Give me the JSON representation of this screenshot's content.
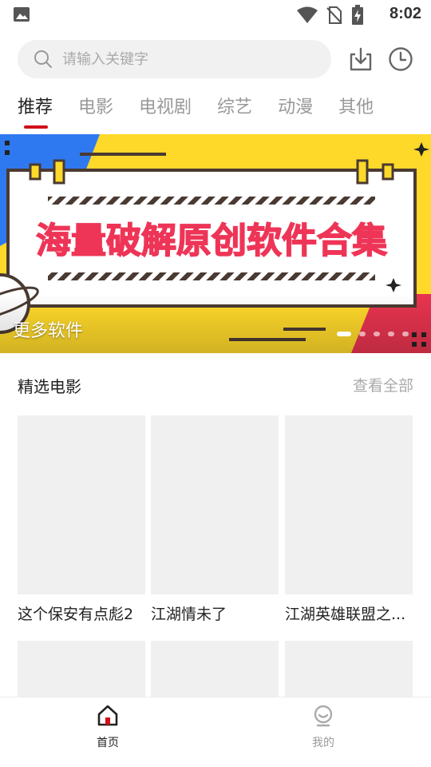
{
  "status_bar": {
    "time": "8:02",
    "icons": [
      "gallery-icon",
      "wifi-icon",
      "no-sim-icon",
      "battery-charging-icon"
    ]
  },
  "search": {
    "placeholder": "请输入关键字"
  },
  "header_actions": [
    "download-icon",
    "history-icon"
  ],
  "tabs": [
    {
      "label": "推荐",
      "active": true
    },
    {
      "label": "电影",
      "active": false
    },
    {
      "label": "电视剧",
      "active": false
    },
    {
      "label": "综艺",
      "active": false
    },
    {
      "label": "动漫",
      "active": false
    },
    {
      "label": "其他",
      "active": false
    }
  ],
  "banner": {
    "headline": "海量破解原创软件合集",
    "caption": "更多软件",
    "slide_count": 5,
    "active_slide": 1
  },
  "section": {
    "title": "精选电影",
    "more_label": "查看全部"
  },
  "movies": [
    {
      "title": "这个保安有点彪2"
    },
    {
      "title": "江湖情未了"
    },
    {
      "title": "江湖英雄联盟之..."
    }
  ],
  "bottom_nav": [
    {
      "label": "首页",
      "icon": "home-icon",
      "active": true
    },
    {
      "label": "我的",
      "icon": "profile-icon",
      "active": false
    }
  ],
  "colors": {
    "accent": "#d0101b",
    "banner_yellow": "#ffd92a",
    "banner_blue": "#2f79f0",
    "banner_red": "#e8344f"
  }
}
